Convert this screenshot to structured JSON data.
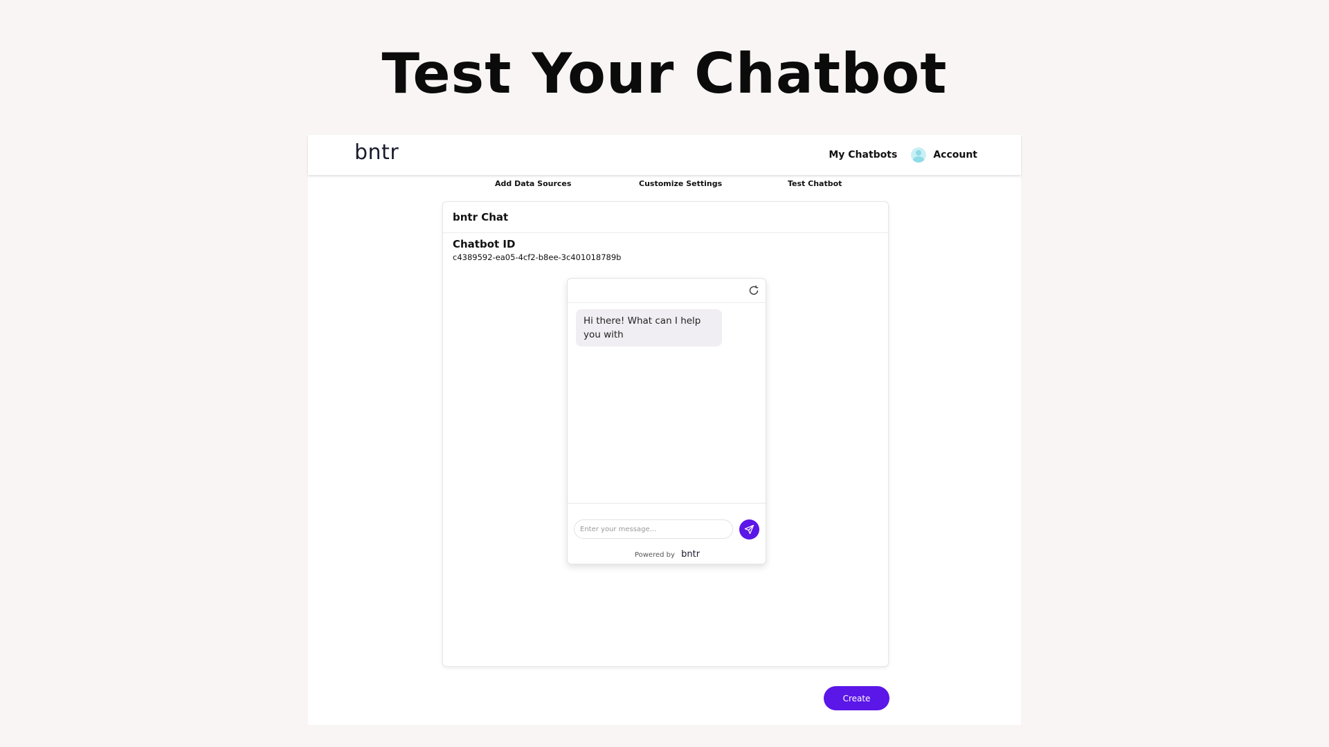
{
  "slide": {
    "title": "Test Your Chatbot"
  },
  "navbar": {
    "logo": "bntr",
    "my_chatbots": "My Chatbots",
    "account": "Account"
  },
  "steps": [
    "Add Data Sources",
    "Customize Settings",
    "Test Chatbot"
  ],
  "card": {
    "title": "bntr Chat",
    "id_label": "Chatbot ID",
    "id_value": "c4389592-ea05-4cf2-b8ee-3c401018789b"
  },
  "chat": {
    "greeting": "Hi there! What can I help you with",
    "input_placeholder": "Enter your message...",
    "powered_by": "Powered by",
    "powered_logo": "bntr"
  },
  "actions": {
    "create_label": "Create"
  },
  "colors": {
    "accent": "#5b16e8",
    "background": "#f8f5f4"
  },
  "icons": {
    "refresh": "refresh-icon",
    "send": "send-icon",
    "avatar": "user-avatar-icon"
  }
}
